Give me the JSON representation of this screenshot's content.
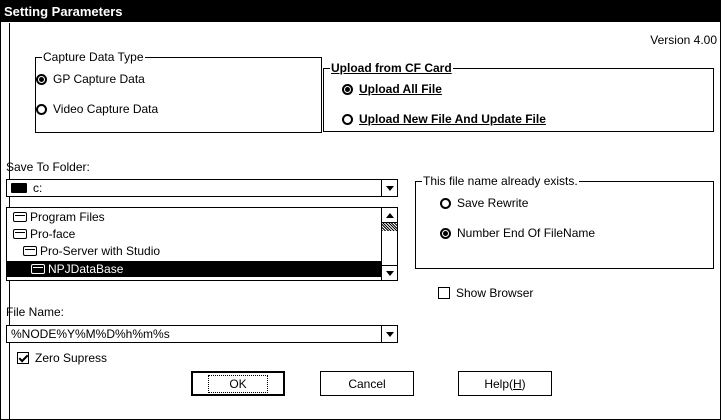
{
  "window": {
    "title": "Setting Parameters",
    "version": "Version 4.00"
  },
  "capture_type": {
    "title": "Capture Data Type",
    "options": [
      {
        "label": "GP Capture Data",
        "selected": true
      },
      {
        "label": "Video Capture Data",
        "selected": false
      }
    ]
  },
  "upload": {
    "title": "Upload from CF Card",
    "options": [
      {
        "label": "Upload All File",
        "selected": true
      },
      {
        "label": "Upload New File And Update File",
        "selected": false
      }
    ]
  },
  "save_folder": {
    "label": "Save To Folder:",
    "drive": "c:",
    "folders": [
      "Program Files",
      "Pro-face",
      "Pro-Server with Studio",
      "NPJDataBase"
    ],
    "selected_index": 3
  },
  "file_exists": {
    "title": "This file name already exists.",
    "options": [
      {
        "label": "Save Rewrite",
        "selected": false
      },
      {
        "label": "Number End Of FileName",
        "selected": true
      }
    ]
  },
  "show_browser": {
    "label": "Show Browser",
    "checked": false
  },
  "file_name": {
    "label": "File Name:",
    "value": "%NODE%Y%M%D%h%m%s"
  },
  "zero_supress": {
    "label": "Zero Supress",
    "checked": true
  },
  "buttons": {
    "ok": "OK",
    "cancel": "Cancel",
    "help_prefix": "Help(",
    "help_key": "H",
    "help_suffix": ")"
  }
}
